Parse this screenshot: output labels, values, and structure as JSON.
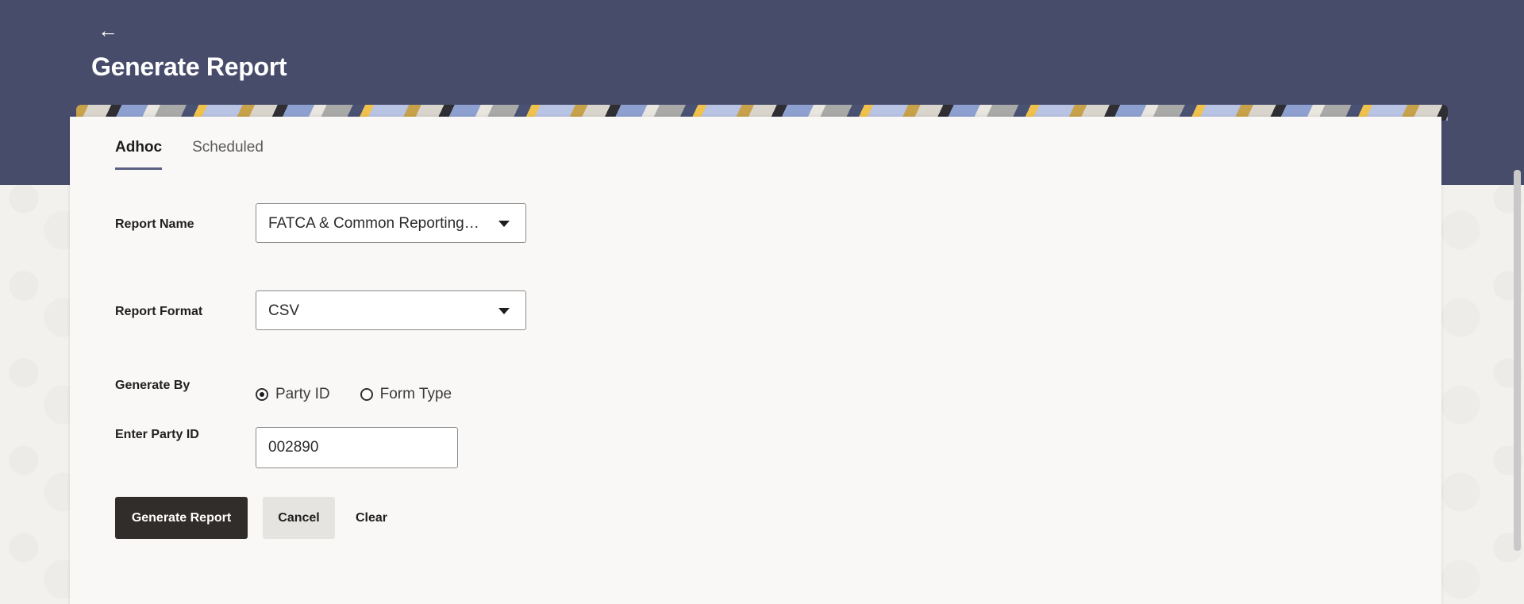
{
  "header": {
    "back_icon": "arrow-left-icon",
    "back_glyph": "←",
    "title": "Generate Report"
  },
  "tabs": [
    {
      "label": "Adhoc",
      "active": true
    },
    {
      "label": "Scheduled",
      "active": false
    }
  ],
  "form": {
    "report_name": {
      "label": "Report Name",
      "value": "FATCA & Common Reporting Standard Report"
    },
    "report_format": {
      "label": "Report Format",
      "value": "CSV"
    },
    "generate_by": {
      "label": "Generate By",
      "options": [
        {
          "label": "Party ID",
          "checked": true
        },
        {
          "label": "Form Type",
          "checked": false
        }
      ]
    },
    "party_id": {
      "label": "Enter Party ID",
      "value": "002890"
    }
  },
  "actions": {
    "generate_label": "Generate Report",
    "cancel_label": "Cancel",
    "clear_label": "Clear"
  },
  "colors": {
    "header_bg": "#474c6b",
    "primary_button": "#312d2a",
    "tab_underline": "#5b5f82"
  }
}
